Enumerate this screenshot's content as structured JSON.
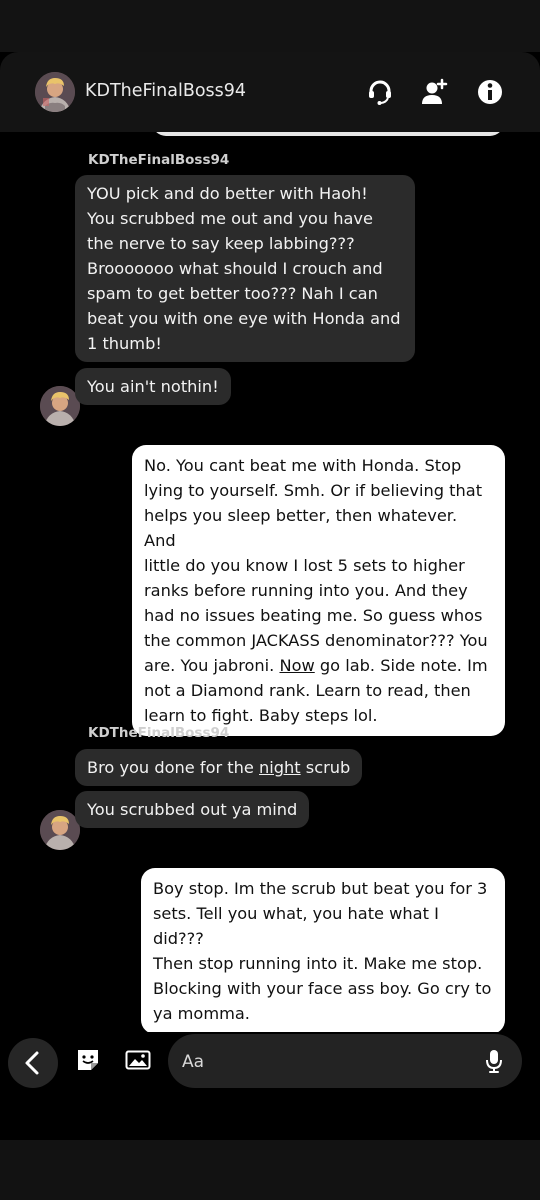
{
  "header": {
    "title": "KDTheFinalBoss94",
    "icons": [
      "avatar",
      "voice-chat-icon",
      "add-friend-icon",
      "info-icon"
    ]
  },
  "messages": {
    "sender_1": "KDTheFinalBoss94",
    "msg_1": "YOU pick and do better with Haoh!\nYou scrubbed me out and you have\nthe nerve to say keep labbing???\nBrooooooo what should I crouch and\nspam to get better too??? Nah I can\nbeat you with one eye with Honda and\n1 thumb!",
    "msg_2": "You ain't nothin!",
    "msg_3_part1": "No. You cant beat me with Honda. Stop\nlying to yourself. Smh. Or if believing that\nhelps you sleep better, then whatever. And\nlittle do you know I lost 5 sets to higher\nranks before running into you. And they\nhad no issues beating me. So guess whos\nthe common JACKASS denominator??? You\nare. You jabroni. ",
    "msg_3_link": "Now",
    "msg_3_part2": " go lab. Side note. Im\nnot a Diamond rank. Learn to read, then\nlearn to fight. Baby steps lol.",
    "sender_2": "KDTheFinalBoss94",
    "msg_4_part1": "Bro you done for the ",
    "msg_4_link": "night",
    "msg_4_part2": " scrub",
    "msg_5": "You scrubbed out ya mind",
    "msg_6": "Boy stop. Im the scrub but beat you for 3\nsets. Tell you what, you hate what I did???\nThen stop running into it. Make me stop.\nBlocking with your face ass boy. Go cry to\nya momma."
  },
  "composer": {
    "placeholder": "Aa",
    "icons": [
      "back-icon",
      "sticker-icon",
      "image-icon",
      "microphone-icon"
    ]
  },
  "colors": {
    "background": "#000000",
    "incoming_bubble": "#2b2b2b",
    "outgoing_bubble": "#ffffff",
    "header_bg": "#141414"
  }
}
